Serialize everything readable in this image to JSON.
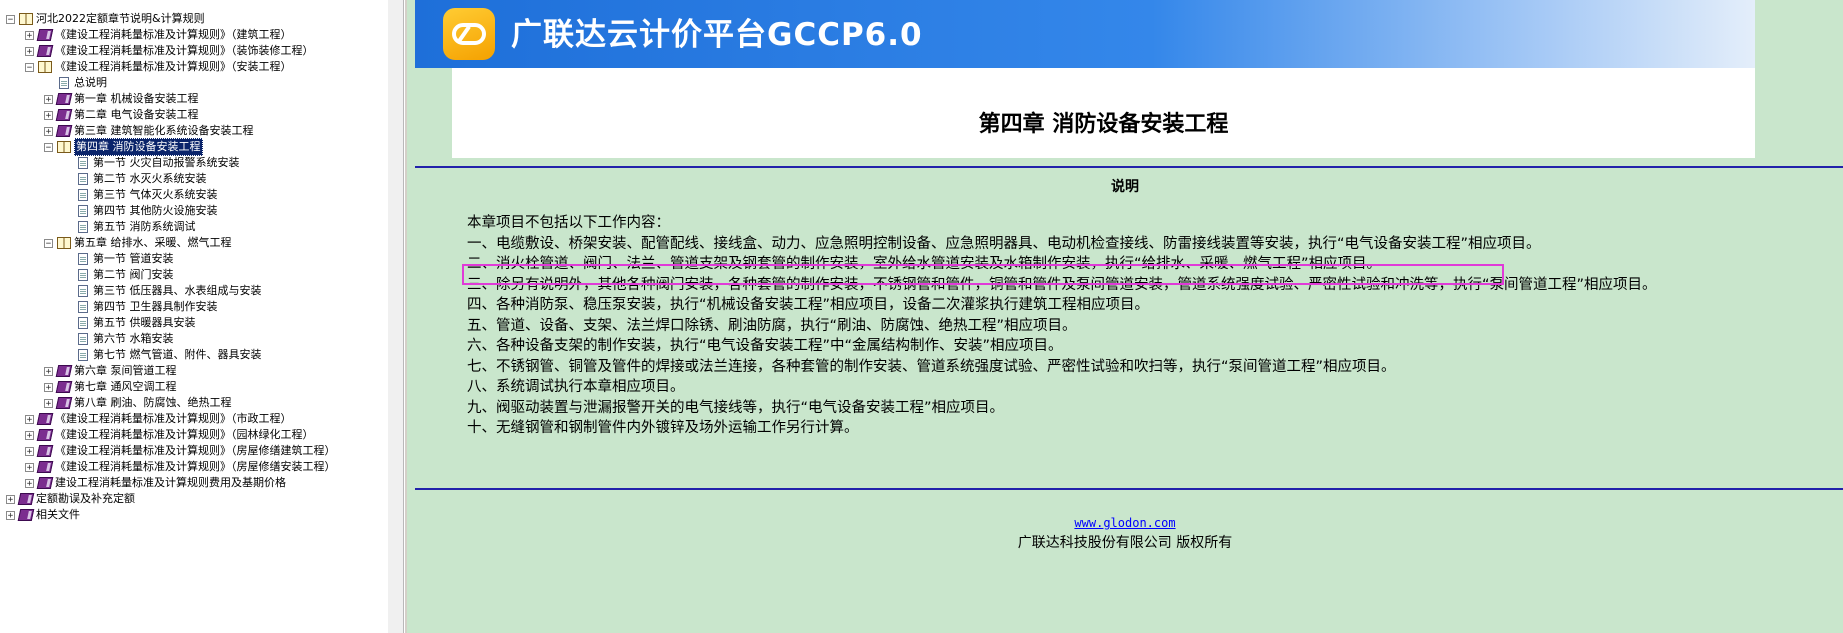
{
  "tree": [
    {
      "depth": 0,
      "exp": "−",
      "icon": "book-open",
      "label": "河北2022定额章节说明&计算规则"
    },
    {
      "depth": 1,
      "exp": "+",
      "icon": "book-closed",
      "label": "《建设工程消耗量标准及计算规则》（建筑工程）"
    },
    {
      "depth": 1,
      "exp": "+",
      "icon": "book-closed",
      "label": "《建设工程消耗量标准及计算规则》（装饰装修工程）"
    },
    {
      "depth": 1,
      "exp": "−",
      "icon": "book-open",
      "label": "《建设工程消耗量标准及计算规则》（安装工程）"
    },
    {
      "depth": 2,
      "exp": "",
      "icon": "page",
      "label": "总说明"
    },
    {
      "depth": 2,
      "exp": "+",
      "icon": "book-closed",
      "label": "第一章  机械设备安装工程"
    },
    {
      "depth": 2,
      "exp": "+",
      "icon": "book-closed",
      "label": "第二章  电气设备安装工程"
    },
    {
      "depth": 2,
      "exp": "+",
      "icon": "book-closed",
      "label": "第三章  建筑智能化系统设备安装工程"
    },
    {
      "depth": 2,
      "exp": "−",
      "icon": "book-open",
      "label": "第四章  消防设备安装工程",
      "selected": true
    },
    {
      "depth": 3,
      "exp": "",
      "icon": "page",
      "label": "第一节  火灾自动报警系统安装"
    },
    {
      "depth": 3,
      "exp": "",
      "icon": "page",
      "label": "第二节  水灭火系统安装"
    },
    {
      "depth": 3,
      "exp": "",
      "icon": "page",
      "label": "第三节  气体灭火系统安装"
    },
    {
      "depth": 3,
      "exp": "",
      "icon": "page",
      "label": "第四节  其他防火设施安装"
    },
    {
      "depth": 3,
      "exp": "",
      "icon": "page",
      "label": "第五节  消防系统调试"
    },
    {
      "depth": 2,
      "exp": "−",
      "icon": "book-open",
      "label": "第五章  给排水、采暖、燃气工程"
    },
    {
      "depth": 3,
      "exp": "",
      "icon": "page",
      "label": "第一节  管道安装"
    },
    {
      "depth": 3,
      "exp": "",
      "icon": "page",
      "label": "第二节  阀门安装"
    },
    {
      "depth": 3,
      "exp": "",
      "icon": "page",
      "label": "第三节  低压器具、水表组成与安装"
    },
    {
      "depth": 3,
      "exp": "",
      "icon": "page",
      "label": "第四节  卫生器具制作安装"
    },
    {
      "depth": 3,
      "exp": "",
      "icon": "page",
      "label": "第五节  供暖器具安装"
    },
    {
      "depth": 3,
      "exp": "",
      "icon": "page",
      "label": "第六节  水箱安装"
    },
    {
      "depth": 3,
      "exp": "",
      "icon": "page",
      "label": "第七节  燃气管道、附件、器具安装"
    },
    {
      "depth": 2,
      "exp": "+",
      "icon": "book-closed",
      "label": "第六章  泵间管道工程"
    },
    {
      "depth": 2,
      "exp": "+",
      "icon": "book-closed",
      "label": "第七章  通风空调工程"
    },
    {
      "depth": 2,
      "exp": "+",
      "icon": "book-closed",
      "label": "第八章  刷油、防腐蚀、绝热工程"
    },
    {
      "depth": 1,
      "exp": "+",
      "icon": "book-closed",
      "label": "《建设工程消耗量标准及计算规则》（市政工程）"
    },
    {
      "depth": 1,
      "exp": "+",
      "icon": "book-closed",
      "label": "《建设工程消耗量标准及计算规则》（园林绿化工程）"
    },
    {
      "depth": 1,
      "exp": "+",
      "icon": "book-closed",
      "label": "《建设工程消耗量标准及计算规则》（房屋修缮建筑工程）"
    },
    {
      "depth": 1,
      "exp": "+",
      "icon": "book-closed",
      "label": "《建设工程消耗量标准及计算规则》（房屋修缮安装工程）"
    },
    {
      "depth": 1,
      "exp": "+",
      "icon": "book-closed",
      "label": "建设工程消耗量标准及计算规则费用及基期价格"
    },
    {
      "depth": 0,
      "exp": "+",
      "icon": "book-closed",
      "label": "定额勘误及补充定额"
    },
    {
      "depth": 0,
      "exp": "+",
      "icon": "book-closed",
      "label": "相关文件"
    }
  ],
  "banner": {
    "title": "广联达云计价平台GCCP6.0"
  },
  "doc": {
    "chapter_title": "第四章  消防设备安装工程",
    "section_title": "说明",
    "lines": [
      "本章项目不包括以下工作内容：",
      "一、电缆敷设、桥架安装、配管配线、接线盒、动力、应急照明控制设备、应急照明器具、电动机检查接线、防雷接线装置等安装，执行“电气设备安装工程”相应项目。",
      "二、消火栓管道、阀门、法兰、管道支架及钢套管的制作安装，室外给水管道安装及水箱制作安装，执行“给排水、采暖、燃气工程”相应项目。",
      "三、除另有说明外，其他各种阀门安装，各种套管的制作安装，不锈钢管和管件，铜管和管件及泵间管道安装，管道系统强度试验、严密性试验和冲洗等，执行“泵间管道工程”相应项目。",
      "四、各种消防泵、稳压泵安装，执行“机械设备安装工程”相应项目，设备二次灌浆执行建筑工程相应项目。",
      "五、管道、设备、支架、法兰焊口除锈、刷油防腐，执行“刷油、防腐蚀、绝热工程”相应项目。",
      "六、各种设备支架的制作安装，执行“电气设备安装工程”中“金属结构制作、安装”相应项目。",
      "七、不锈钢管、铜管及管件的焊接或法兰连接，各种套管的制作安装、管道系统强度试验、严密性试验和吹扫等，执行“泵间管道工程”相应项目。",
      "八、系统调试执行本章相应项目。",
      "九、阀驱动装置与泄漏报警开关的电气接线等，执行“电气设备安装工程”相应项目。",
      "十、无缝钢管和钢制管件内外镀锌及场外运输工作另行计算。"
    ],
    "highlighted_line_index": 2
  },
  "footer": {
    "link": "www.glodon.com",
    "copyright": "广联达科技股份有限公司  版权所有"
  },
  "colors": {
    "content_bg": "#c9e6cc",
    "banner_blue": "#1e6fd9",
    "rule_line": "#2222aa",
    "highlight_border": "#e03ad8",
    "tree_selected": "#0a246a"
  }
}
